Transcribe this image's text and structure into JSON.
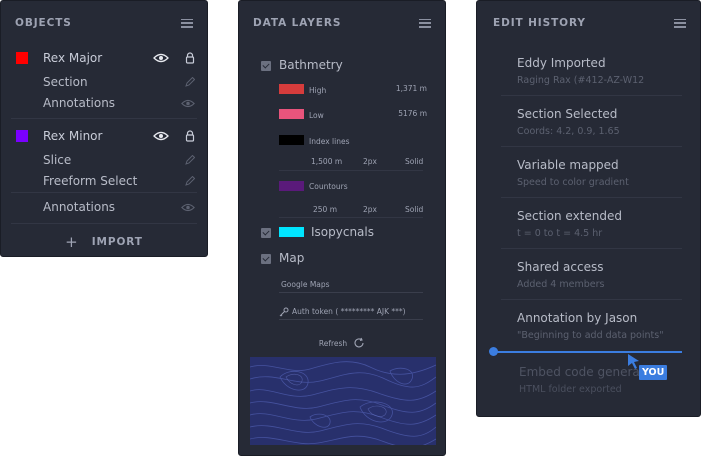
{
  "objects": {
    "title": "OBJECTS",
    "rows": [
      {
        "label": "Rex Major",
        "swatch": "#ff0000"
      },
      {
        "label": "Section"
      },
      {
        "label": "Annotations"
      },
      {
        "label": "Rex Minor",
        "swatch": "#7a00ff"
      },
      {
        "label": "Slice"
      },
      {
        "label": "Freeform Select"
      },
      {
        "label": "Annotations"
      }
    ],
    "import_label": "IMPORT",
    "import_icon": "+"
  },
  "layers": {
    "title": "DATA LAYERS",
    "bathymetry": {
      "label": "Bathmetry",
      "legend": [
        {
          "label": "High",
          "value": "1,371 m",
          "color": "#d63c3c"
        },
        {
          "label": "Low",
          "value": "5176 m",
          "color": "#e8547c"
        },
        {
          "label": "Index lines",
          "value": "",
          "color": "#000000"
        }
      ],
      "index_props": [
        "1,500 m",
        "2px",
        "Solid"
      ],
      "contours": {
        "label": "Countours",
        "color": "#5a1a7a"
      },
      "contour_props": [
        "250 m",
        "2px",
        "Solid"
      ]
    },
    "isopycnals": {
      "label": "Isopycnals",
      "color": "#00e5ff"
    },
    "map": {
      "label": "Map",
      "source": "Google Maps",
      "auth_token": "Auth token ( ********* AJK ***)",
      "refresh": "Refresh"
    }
  },
  "history": {
    "title": "EDIT HISTORY",
    "items": [
      {
        "title": "Eddy Imported",
        "sub": "Raging Rax (#412-AZ-W12"
      },
      {
        "title": "Section Selected",
        "sub": "Coords: 4.2, 0.9, 1.65"
      },
      {
        "title": "Variable mapped",
        "sub": "Speed to color gradient"
      },
      {
        "title": "Section extended",
        "sub": "t = 0 to t = 4.5 hr"
      },
      {
        "title": "Shared access",
        "sub": "Added 4 members"
      },
      {
        "title": "Annotation by Jason",
        "sub": "\"Beginning to add data points\""
      },
      {
        "title": "Embed code generated",
        "sub": "HTML folder exported"
      }
    ],
    "you_label": "YOU",
    "accent": "#3b7de0"
  }
}
